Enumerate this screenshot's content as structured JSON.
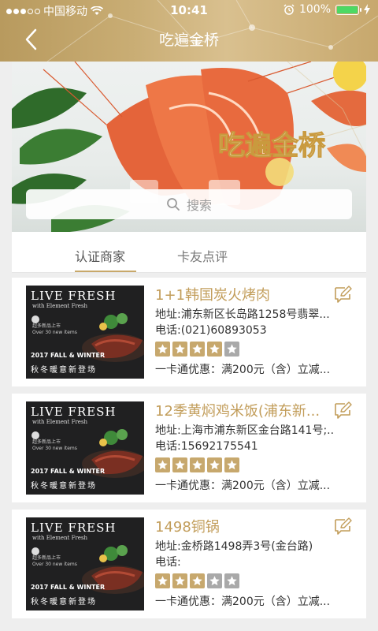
{
  "status_bar": {
    "carrier": "中国移动",
    "time": "10:41",
    "battery": "100%"
  },
  "nav": {
    "title": "吃遍金桥"
  },
  "banner": {
    "logo_text": "吃遍金桥"
  },
  "search": {
    "placeholder": "搜索"
  },
  "tabs": [
    {
      "label": "认证商家",
      "active": true
    },
    {
      "label": "卡友点评",
      "active": false
    }
  ],
  "thumb_art": {
    "line1": "LIVE FRESH",
    "line2": "with Element Fresh",
    "line3": "超多新品上市",
    "line4": "Over 30 new items",
    "line5": "2017 FALL & WINTER",
    "line6": "秋冬暖意新登场"
  },
  "merchants": [
    {
      "name": "1+1韩国炭火烤肉",
      "address": "地址:浦东新区长岛路1258号翡翠...",
      "phone": "电话:(021)60893053",
      "rating": 4,
      "promo": "一卡通优惠：满200元（含）立减..."
    },
    {
      "name": "12季黄焖鸡米饭(浦东新...",
      "address": "地址:上海市浦东新区金台路141号;...",
      "phone": "电话:15692175541",
      "rating": 5,
      "promo": "一卡通优惠：满200元（含）立减..."
    },
    {
      "name": "1498铜锅",
      "address": "地址:金桥路1498弄3号(金台路)",
      "phone": "电话:",
      "rating": 3,
      "promo": "一卡通优惠：满200元（含）立减..."
    }
  ],
  "colors": {
    "gold": "#c7a86d",
    "merchant_name": "#c29d5a",
    "star_off": "#a9a9a9"
  }
}
